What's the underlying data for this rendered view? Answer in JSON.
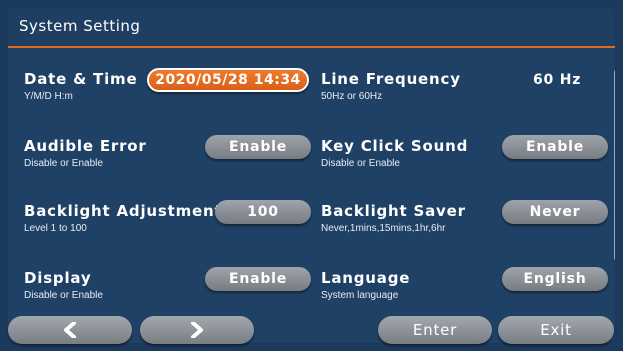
{
  "window": {
    "title": "System Setting"
  },
  "settings": {
    "date_time": {
      "name": "Date & Time",
      "hint": "Y/M/D H:m",
      "value": "2020/05/28 14:34"
    },
    "line_frequency": {
      "name": "Line Frequency",
      "hint": "50Hz or 60Hz",
      "value": "60 Hz"
    },
    "audible_error": {
      "name": "Audible Error",
      "hint": "Disable or Enable",
      "value": "Enable"
    },
    "key_click_sound": {
      "name": "Key Click Sound",
      "hint": "Disable or Enable",
      "value": "Enable"
    },
    "backlight_adjustment": {
      "name": "Backlight Adjustment",
      "hint": "Level 1 to 100",
      "value": "100"
    },
    "backlight_saver": {
      "name": "Backlight Saver",
      "hint": "Never,1mins,15mins,1hr,6hr",
      "value": "Never"
    },
    "display": {
      "name": "Display",
      "hint": "Disable or Enable",
      "value": "Enable"
    },
    "language": {
      "name": "Language",
      "hint": "System language",
      "value": "English"
    }
  },
  "footer": {
    "prev_icon": "chevron-left-icon",
    "next_icon": "chevron-right-icon",
    "enter_label": "Enter",
    "exit_label": "Exit"
  },
  "colors": {
    "background": "#1f4166",
    "accent": "#e06a1e",
    "button": "#8c9197"
  }
}
